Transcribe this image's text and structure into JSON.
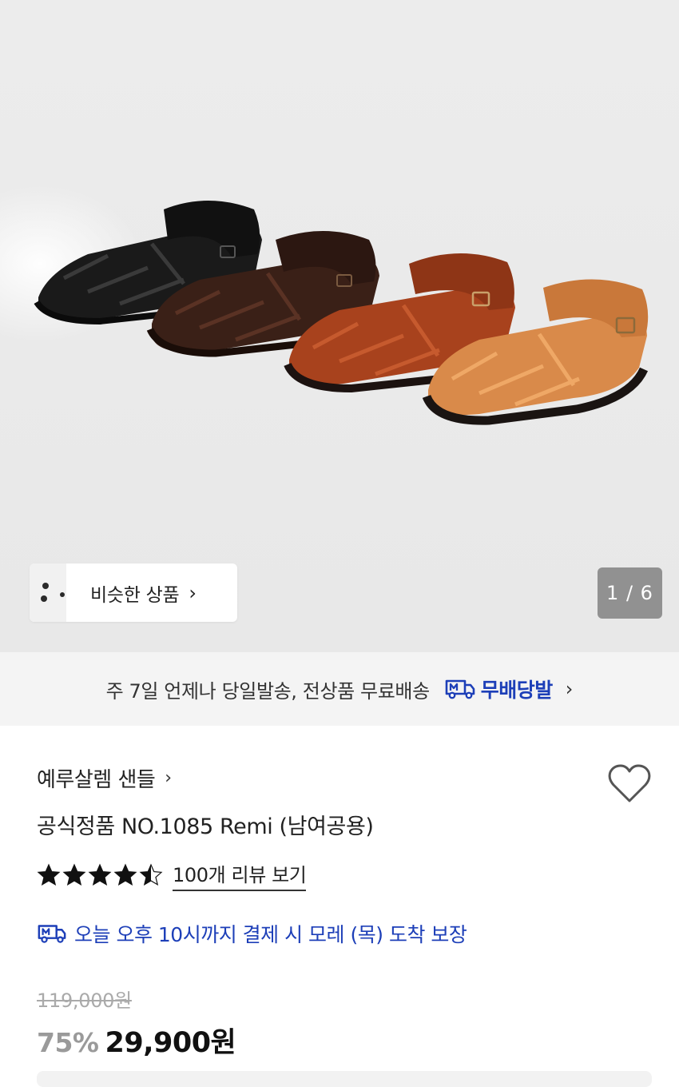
{
  "gallery": {
    "counter": "1 / 6",
    "similar_label": "비슷한 상품",
    "similar_chevron": "›"
  },
  "shipping_banner": {
    "text": "주 7일 언제나 당일발송, 전상품 무료배송",
    "icon": "truck-m-icon",
    "brand": "무배당발",
    "chevron": "›"
  },
  "product": {
    "brand": "예루살렘 샌들",
    "brand_chevron": "›",
    "title": "공식정품 NO.1085 Remi (남여공용)",
    "rating": 4.5,
    "rating_max": 5,
    "review_link": "100개 리뷰 보기",
    "delivery_text": "오늘 오후 10시까지 결제 시 모레 (목) 도착 보장",
    "original_price": "119,000원",
    "discount": "75%",
    "sale_price": "29,900원"
  },
  "colors": {
    "accent_blue": "#1d3fb8",
    "banner_bg": "#f4f4f4",
    "hero_bg": "#e9e9e9"
  }
}
